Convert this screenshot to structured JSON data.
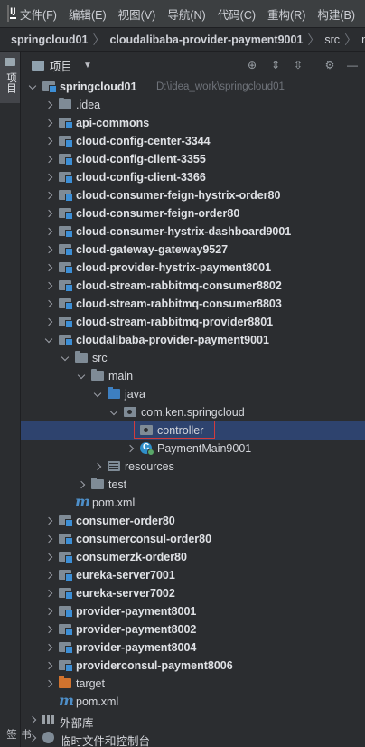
{
  "menu": [
    "文件(F)",
    "编辑(E)",
    "视图(V)",
    "导航(N)",
    "代码(C)",
    "重构(R)",
    "构建(B)"
  ],
  "breadcrumb": [
    "springcloud01",
    "cloudalibaba-provider-payment9001",
    "src",
    "ma"
  ],
  "toolstrip": {
    "project_label": "项目",
    "bottom_label": "书签"
  },
  "toolwindow": {
    "title": "项目"
  },
  "tree": [
    {
      "label": "springcloud01",
      "hint": "D:\\idea_work\\springcloud01",
      "depth": 0,
      "arrow": "down",
      "icon": "module",
      "bold": true
    },
    {
      "label": ".idea",
      "depth": 1,
      "arrow": "right",
      "icon": "folder"
    },
    {
      "label": "api-commons",
      "depth": 1,
      "arrow": "right",
      "icon": "module",
      "bold": true
    },
    {
      "label": "cloud-config-center-3344",
      "depth": 1,
      "arrow": "right",
      "icon": "module",
      "bold": true
    },
    {
      "label": "cloud-config-client-3355",
      "depth": 1,
      "arrow": "right",
      "icon": "module",
      "bold": true
    },
    {
      "label": "cloud-config-client-3366",
      "depth": 1,
      "arrow": "right",
      "icon": "module",
      "bold": true
    },
    {
      "label": "cloud-consumer-feign-hystrix-order80",
      "depth": 1,
      "arrow": "right",
      "icon": "module",
      "bold": true
    },
    {
      "label": "cloud-consumer-feign-order80",
      "depth": 1,
      "arrow": "right",
      "icon": "module",
      "bold": true
    },
    {
      "label": "cloud-consumer-hystrix-dashboard9001",
      "depth": 1,
      "arrow": "right",
      "icon": "module",
      "bold": true
    },
    {
      "label": "cloud-gateway-gateway9527",
      "depth": 1,
      "arrow": "right",
      "icon": "module",
      "bold": true
    },
    {
      "label": "cloud-provider-hystrix-payment8001",
      "depth": 1,
      "arrow": "right",
      "icon": "module",
      "bold": true
    },
    {
      "label": "cloud-stream-rabbitmq-consumer8802",
      "depth": 1,
      "arrow": "right",
      "icon": "module",
      "bold": true
    },
    {
      "label": "cloud-stream-rabbitmq-consumer8803",
      "depth": 1,
      "arrow": "right",
      "icon": "module",
      "bold": true
    },
    {
      "label": "cloud-stream-rabbitmq-provider8801",
      "depth": 1,
      "arrow": "right",
      "icon": "module",
      "bold": true
    },
    {
      "label": "cloudalibaba-provider-payment9001",
      "depth": 1,
      "arrow": "down",
      "icon": "module",
      "bold": true
    },
    {
      "label": "src",
      "depth": 2,
      "arrow": "down",
      "icon": "folder"
    },
    {
      "label": "main",
      "depth": 3,
      "arrow": "down",
      "icon": "folder"
    },
    {
      "label": "java",
      "depth": 4,
      "arrow": "down",
      "icon": "srcfolder"
    },
    {
      "label": "com.ken.springcloud",
      "depth": 5,
      "arrow": "down",
      "icon": "pkg"
    },
    {
      "label": "controller",
      "depth": 6,
      "arrow": "none",
      "icon": "pkg",
      "selected": true
    },
    {
      "label": "PaymentMain9001",
      "depth": 6,
      "arrow": "right",
      "icon": "javaclass"
    },
    {
      "label": "resources",
      "depth": 4,
      "arrow": "right",
      "icon": "resfolder"
    },
    {
      "label": "test",
      "depth": 3,
      "arrow": "right",
      "icon": "folder"
    },
    {
      "label": "pom.xml",
      "depth": 2,
      "arrow": "none",
      "icon": "maven"
    },
    {
      "label": "consumer-order80",
      "depth": 1,
      "arrow": "right",
      "icon": "module",
      "bold": true
    },
    {
      "label": "consumerconsul-order80",
      "depth": 1,
      "arrow": "right",
      "icon": "module",
      "bold": true
    },
    {
      "label": "consumerzk-order80",
      "depth": 1,
      "arrow": "right",
      "icon": "module",
      "bold": true
    },
    {
      "label": "eureka-server7001",
      "depth": 1,
      "arrow": "right",
      "icon": "module",
      "bold": true
    },
    {
      "label": "eureka-server7002",
      "depth": 1,
      "arrow": "right",
      "icon": "module",
      "bold": true
    },
    {
      "label": "provider-payment8001",
      "depth": 1,
      "arrow": "right",
      "icon": "module",
      "bold": true
    },
    {
      "label": "provider-payment8002",
      "depth": 1,
      "arrow": "right",
      "icon": "module",
      "bold": true
    },
    {
      "label": "provider-payment8004",
      "depth": 1,
      "arrow": "right",
      "icon": "module",
      "bold": true
    },
    {
      "label": "providerconsul-payment8006",
      "depth": 1,
      "arrow": "right",
      "icon": "module",
      "bold": true
    },
    {
      "label": "target",
      "depth": 1,
      "arrow": "right",
      "icon": "excluded"
    },
    {
      "label": "pom.xml",
      "depth": 1,
      "arrow": "none",
      "icon": "maven"
    },
    {
      "label": "外部库",
      "depth": 0,
      "arrow": "right",
      "icon": "library"
    },
    {
      "label": "临时文件和控制台",
      "depth": 0,
      "arrow": "right",
      "icon": "scratch"
    }
  ],
  "colors": {
    "background": "#2b2d30",
    "selection": "#2e436e",
    "highlight_box": "#d23c3c",
    "module_badge": "#3d8fd6",
    "excluded_folder": "#d1732e"
  }
}
